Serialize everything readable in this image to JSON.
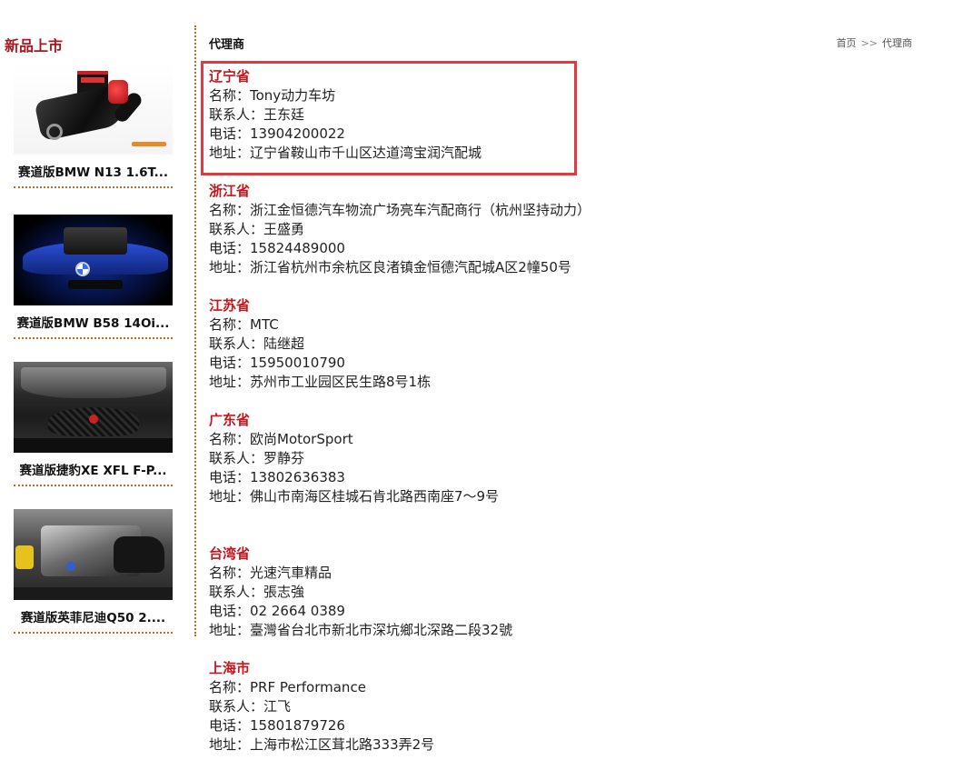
{
  "sidebar": {
    "title": "新品上市",
    "products": [
      {
        "name": "赛道版BMW N13 1.6T..."
      },
      {
        "name": "赛道版BMW B58 14Oi..."
      },
      {
        "name": "赛道版捷豹XE XFL F-P..."
      },
      {
        "name": "赛道版英菲尼迪Q50 2...."
      }
    ]
  },
  "main": {
    "title": "代理商",
    "breadcrumb": {
      "home": "首页",
      "sep": ">>",
      "current": "代理商"
    }
  },
  "dealers": [
    {
      "province": "辽宁省",
      "name": "名称：Tony动力车坊",
      "contact": "联系人：王东廷",
      "phone": "电话：13904200022",
      "address": "地址：辽宁省鞍山市千山区达道湾宝润汽配城"
    },
    {
      "province": "浙江省",
      "name": "名称：浙江金恒德汽车物流广场亮车汽配商行（杭州坚持动力）",
      "contact": "联系人：王盛勇",
      "phone": "电话：15824489000",
      "address": "地址：浙江省杭州市余杭区良渚镇金恒德汽配城A区2幢50号"
    },
    {
      "province": "江苏省",
      "name": "名称：MTC",
      "contact": "联系人：陆继超",
      "phone": "电话：15950010790",
      "address": "地址：苏州市工业园区民生路8号1栋"
    },
    {
      "province": "广东省",
      "name": "名称：欧尚MotorSport",
      "contact": "联系人：罗静芬",
      "phone": "电话：13802636383",
      "address": "地址：佛山市南海区桂城石肯北路西南座7～9号"
    },
    {
      "province": "台湾省",
      "name": "名称：光速汽車精品",
      "contact": "联系人：張志強",
      "phone": "电话：02 2664 0389",
      "address": "地址：臺灣省台北市新北市深坑鄉北深路二段32號"
    },
    {
      "province": "上海市",
      "name": "名称：PRF Performance",
      "contact": "联系人：江飞",
      "phone": "电话：15801879726",
      "address": "地址：上海市松江区茸北路333弄2号"
    }
  ],
  "colors": {
    "accent": "#c4161c",
    "highlight_border": "#e0393e",
    "divider": "#c06a1a"
  }
}
